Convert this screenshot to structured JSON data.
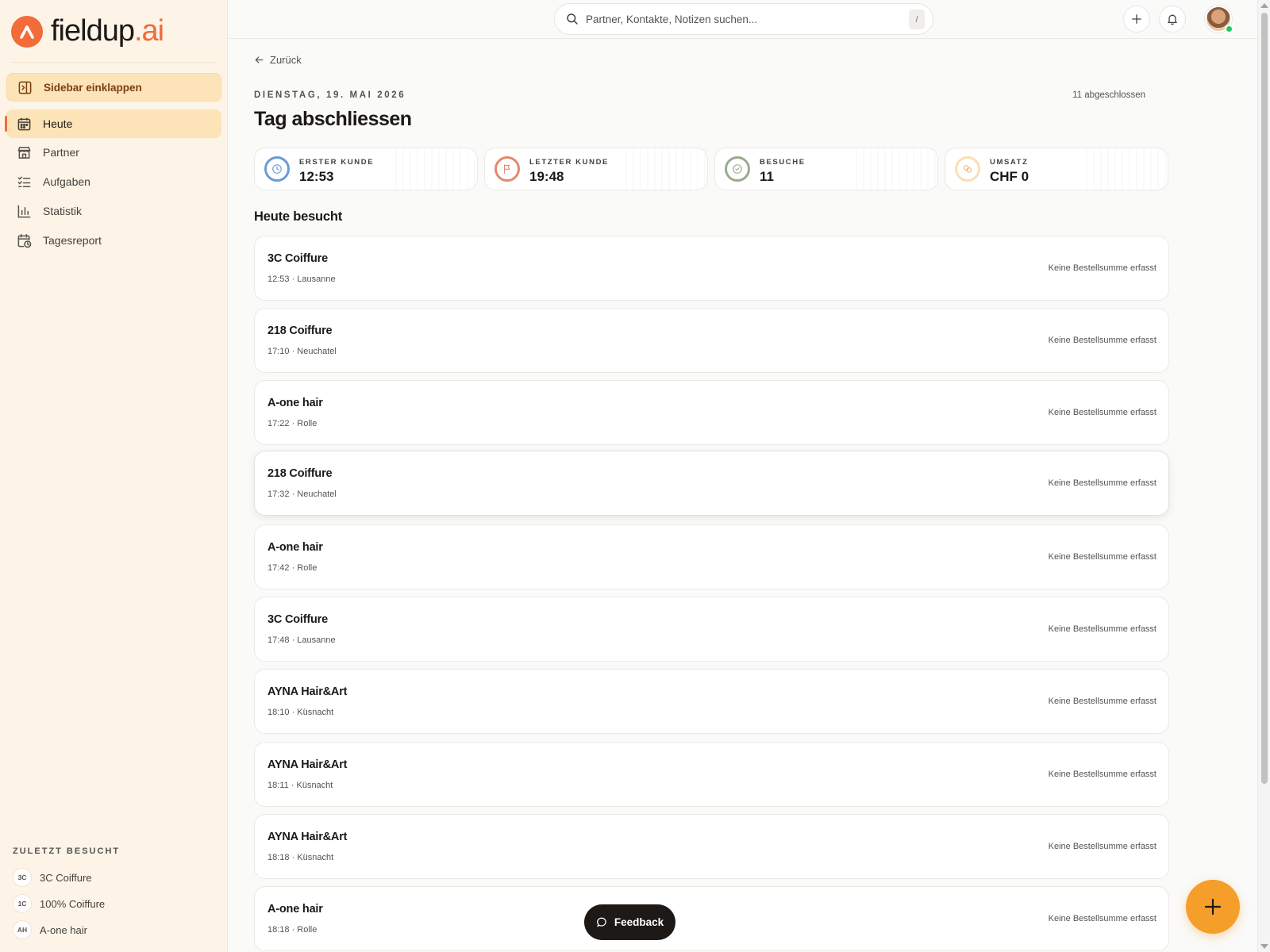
{
  "brand": {
    "name": "fieldup",
    "suffix": ".ai"
  },
  "sidebar": {
    "collapse_label": "Sidebar einklappen",
    "items": [
      {
        "label": "Heute",
        "icon": "calendar-icon",
        "active": true
      },
      {
        "label": "Partner",
        "icon": "store-icon"
      },
      {
        "label": "Aufgaben",
        "icon": "task-list-icon"
      },
      {
        "label": "Statistik",
        "icon": "bar-chart-icon"
      },
      {
        "label": "Tagesreport",
        "icon": "calendar-clock-icon"
      }
    ],
    "recent_title": "ZULETZT BESUCHT",
    "recent": [
      {
        "badge": "3C",
        "label": "3C Coiffure"
      },
      {
        "badge": "1C",
        "label": "100% Coiffure"
      },
      {
        "badge": "AH",
        "label": "A-one hair"
      }
    ]
  },
  "topbar": {
    "search_placeholder": "Partner, Kontakte, Notizen suchen...",
    "shortcut": "/"
  },
  "main": {
    "back_label": "Zurück",
    "date": "DIENSTAG, 19. MAI 2026",
    "closed_count": "11 abgeschlossen",
    "title": "Tag abschliessen",
    "stats": [
      {
        "label": "ERSTER KUNDE",
        "value": "12:53",
        "icon": "clock-icon",
        "color": "#6b9bd2"
      },
      {
        "label": "LETZTER KUNDE",
        "value": "19:48",
        "icon": "flag-icon",
        "color": "#e08b6e"
      },
      {
        "label": "BESUCHE",
        "value": "11",
        "icon": "check-circle-icon",
        "color": "#9aaa90"
      },
      {
        "label": "UMSATZ",
        "value": "CHF 0",
        "icon": "coins-icon",
        "color": "#f4c88a"
      }
    ],
    "section_title": "Heute besucht",
    "visits": [
      {
        "name": "3C Coiffure",
        "meta": "12:53 · Lausanne",
        "sum": "Keine Bestellsumme erfasst"
      },
      {
        "name": "218 Coiffure",
        "meta": "17:10 · Neuchatel",
        "sum": "Keine Bestellsumme erfasst"
      },
      {
        "name": "A-one hair",
        "meta": "17:22 · Rolle",
        "sum": "Keine Bestellsumme erfasst"
      },
      {
        "name": "218 Coiffure",
        "meta": "17:32 · Neuchatel",
        "sum": "Keine Bestellsumme erfasst"
      },
      {
        "name": "A-one hair",
        "meta": "17:42 · Rolle",
        "sum": "Keine Bestellsumme erfasst"
      },
      {
        "name": "3C Coiffure",
        "meta": "17:48 · Lausanne",
        "sum": "Keine Bestellsumme erfasst"
      },
      {
        "name": "AYNA Hair&Art",
        "meta": "18:10 · Küsnacht",
        "sum": "Keine Bestellsumme erfasst"
      },
      {
        "name": "AYNA Hair&Art",
        "meta": "18:11 · Küsnacht",
        "sum": "Keine Bestellsumme erfasst"
      },
      {
        "name": "AYNA Hair&Art",
        "meta": "18:18 · Küsnacht",
        "sum": "Keine Bestellsumme erfasst"
      },
      {
        "name": "A-one hair",
        "meta": "18:18 · Rolle",
        "sum": "Keine Bestellsumme erfasst"
      }
    ]
  },
  "feedback_label": "Feedback",
  "colors": {
    "accent": "#f26b38",
    "sidebar_bg": "#fdf4e7",
    "active_bg": "#fde3b8",
    "fab": "#f59e2a"
  }
}
